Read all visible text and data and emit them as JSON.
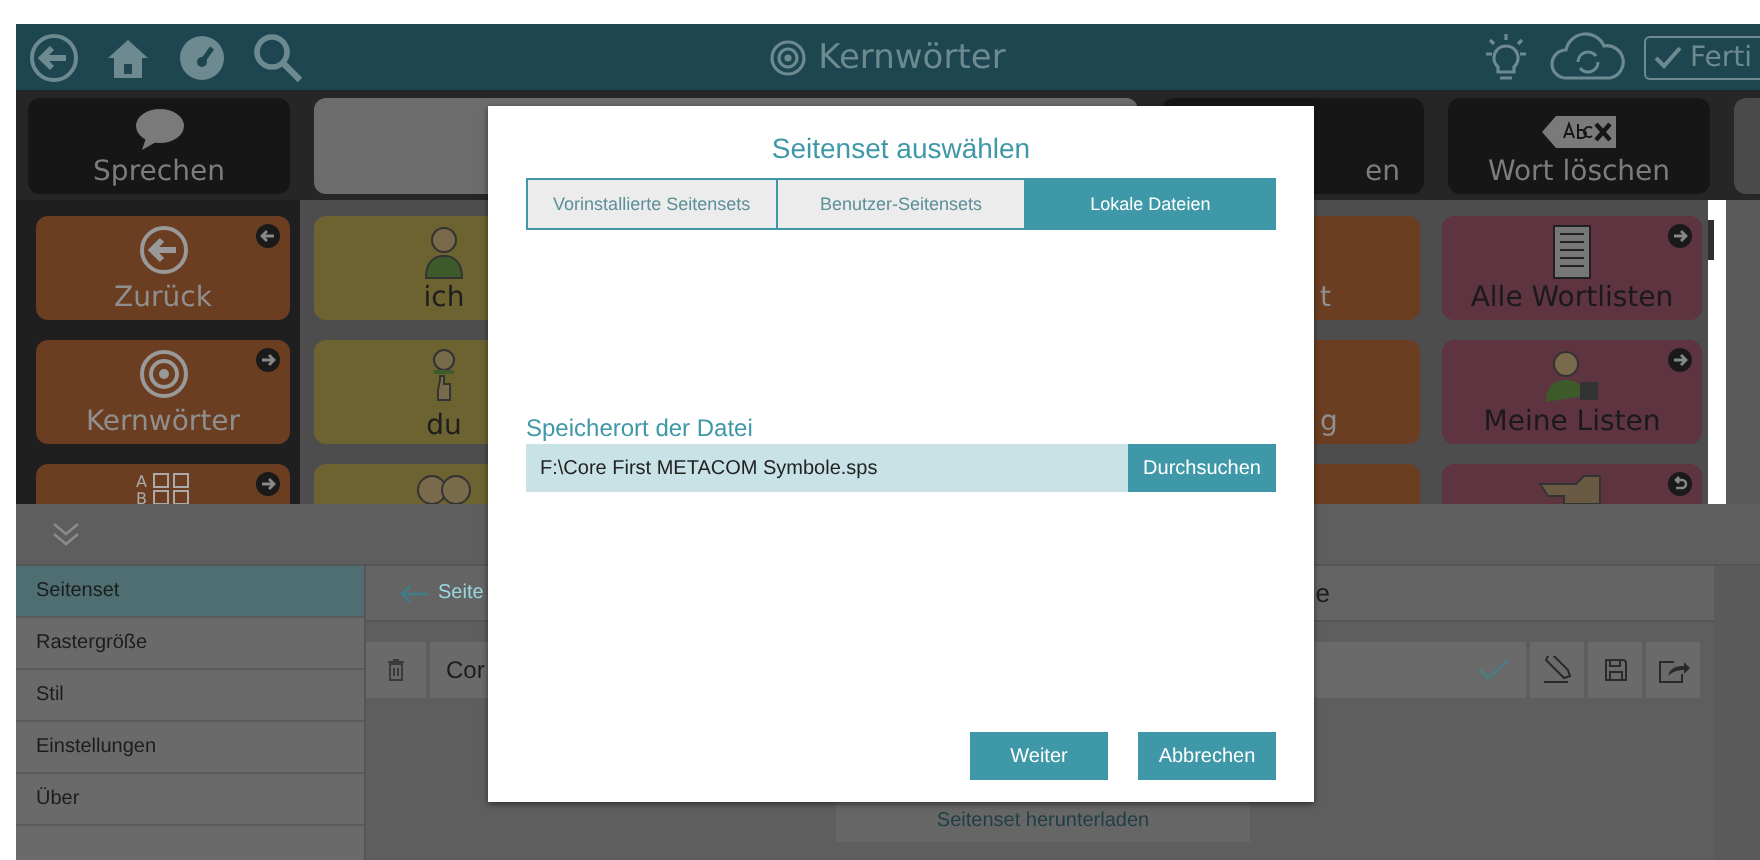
{
  "top_bar": {
    "title": "Kernwörter",
    "done_button": "Ferti"
  },
  "toolbar": [
    {
      "kind": "speak",
      "label": "Sprechen"
    },
    {
      "kind": "message"
    },
    {
      "kind": "delete",
      "label": "en"
    },
    {
      "kind": "delete-word",
      "label": "Wort löschen"
    },
    {
      "kind": "partial"
    }
  ],
  "columns": [
    {
      "kind": "nav",
      "tiles": [
        {
          "label": "Zurück",
          "kind": "back-link"
        },
        {
          "label": "Kernwörter",
          "kind": "forward-link"
        },
        {
          "symbol_letters": [
            "A",
            "B"
          ],
          "kind": "forward-link"
        }
      ]
    },
    {
      "kind": "pronoun",
      "tiles": [
        {
          "label": "ich",
          "kind": "word"
        },
        {
          "label": "du",
          "kind": "word"
        },
        {
          "kind": "word"
        }
      ]
    },
    {
      "kind": "nav",
      "tiles": [
        {
          "label": "t",
          "kind": "word"
        },
        {
          "label": "g",
          "kind": "word"
        },
        {
          "kind": "word"
        }
      ]
    },
    {
      "kind": "list",
      "tiles": [
        {
          "label": "Alle Wortlisten",
          "kind": "forward-link"
        },
        {
          "label": "Meine Listen",
          "kind": "forward-link"
        },
        {
          "kind": "return-link"
        }
      ]
    }
  ],
  "sidebar": {
    "items": [
      {
        "label": "Seitenset",
        "selected": true
      },
      {
        "label": "Rastergröße",
        "selected": false
      },
      {
        "label": "Stil",
        "selected": false
      },
      {
        "label": "Einstellungen",
        "selected": false
      },
      {
        "label": "Über",
        "selected": false
      }
    ]
  },
  "content": {
    "back_link": "Seite",
    "header_fragment": "e",
    "row": {
      "name": "Cor"
    },
    "download_button": "Seitenset herunterladen"
  },
  "dialog": {
    "title": "Seitenset auswählen",
    "tabs": [
      {
        "label": "Vorinstallierte Seitensets",
        "selected": false
      },
      {
        "label": "Benutzer-Seitensets",
        "selected": false
      },
      {
        "label": "Lokale Dateien",
        "selected": true
      }
    ],
    "field_label": "Speicherort der Datei",
    "field_value": "F:\\Core First METACOM Symbole.sps",
    "browse_button": "Durchsuchen",
    "buttons": [
      "Weiter",
      "Abbrechen"
    ]
  }
}
